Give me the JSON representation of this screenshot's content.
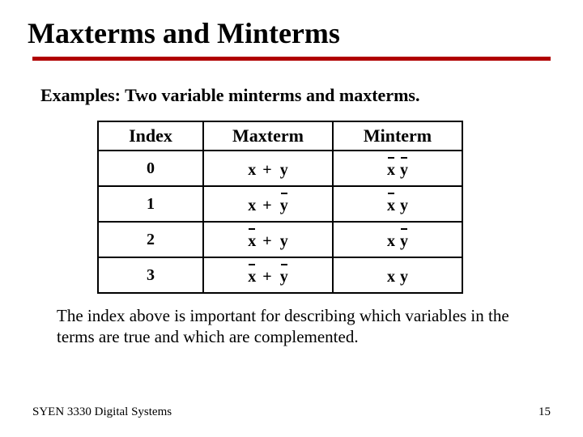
{
  "title": "Maxterms and Minterms",
  "subtitle": "Examples: Two variable minterms and maxterms.",
  "table": {
    "headers": {
      "index": "Index",
      "maxterm": "Maxterm",
      "minterm": "Minterm"
    },
    "rows": [
      {
        "index": "0",
        "maxterm": {
          "x_bar": false,
          "y_bar": false
        },
        "minterm": {
          "x_bar": true,
          "y_bar": true
        }
      },
      {
        "index": "1",
        "maxterm": {
          "x_bar": false,
          "y_bar": true
        },
        "minterm": {
          "x_bar": true,
          "y_bar": false
        }
      },
      {
        "index": "2",
        "maxterm": {
          "x_bar": true,
          "y_bar": false
        },
        "minterm": {
          "x_bar": false,
          "y_bar": true
        }
      },
      {
        "index": "3",
        "maxterm": {
          "x_bar": true,
          "y_bar": true
        },
        "minterm": {
          "x_bar": false,
          "y_bar": false
        }
      }
    ],
    "vars": {
      "x": "x",
      "y": "y",
      "plus": "+"
    }
  },
  "note": "The index above is important for describing which variables in the terms are true and which are complemented.",
  "footer": {
    "left": "SYEN 3330 Digital Systems",
    "right": "15"
  }
}
